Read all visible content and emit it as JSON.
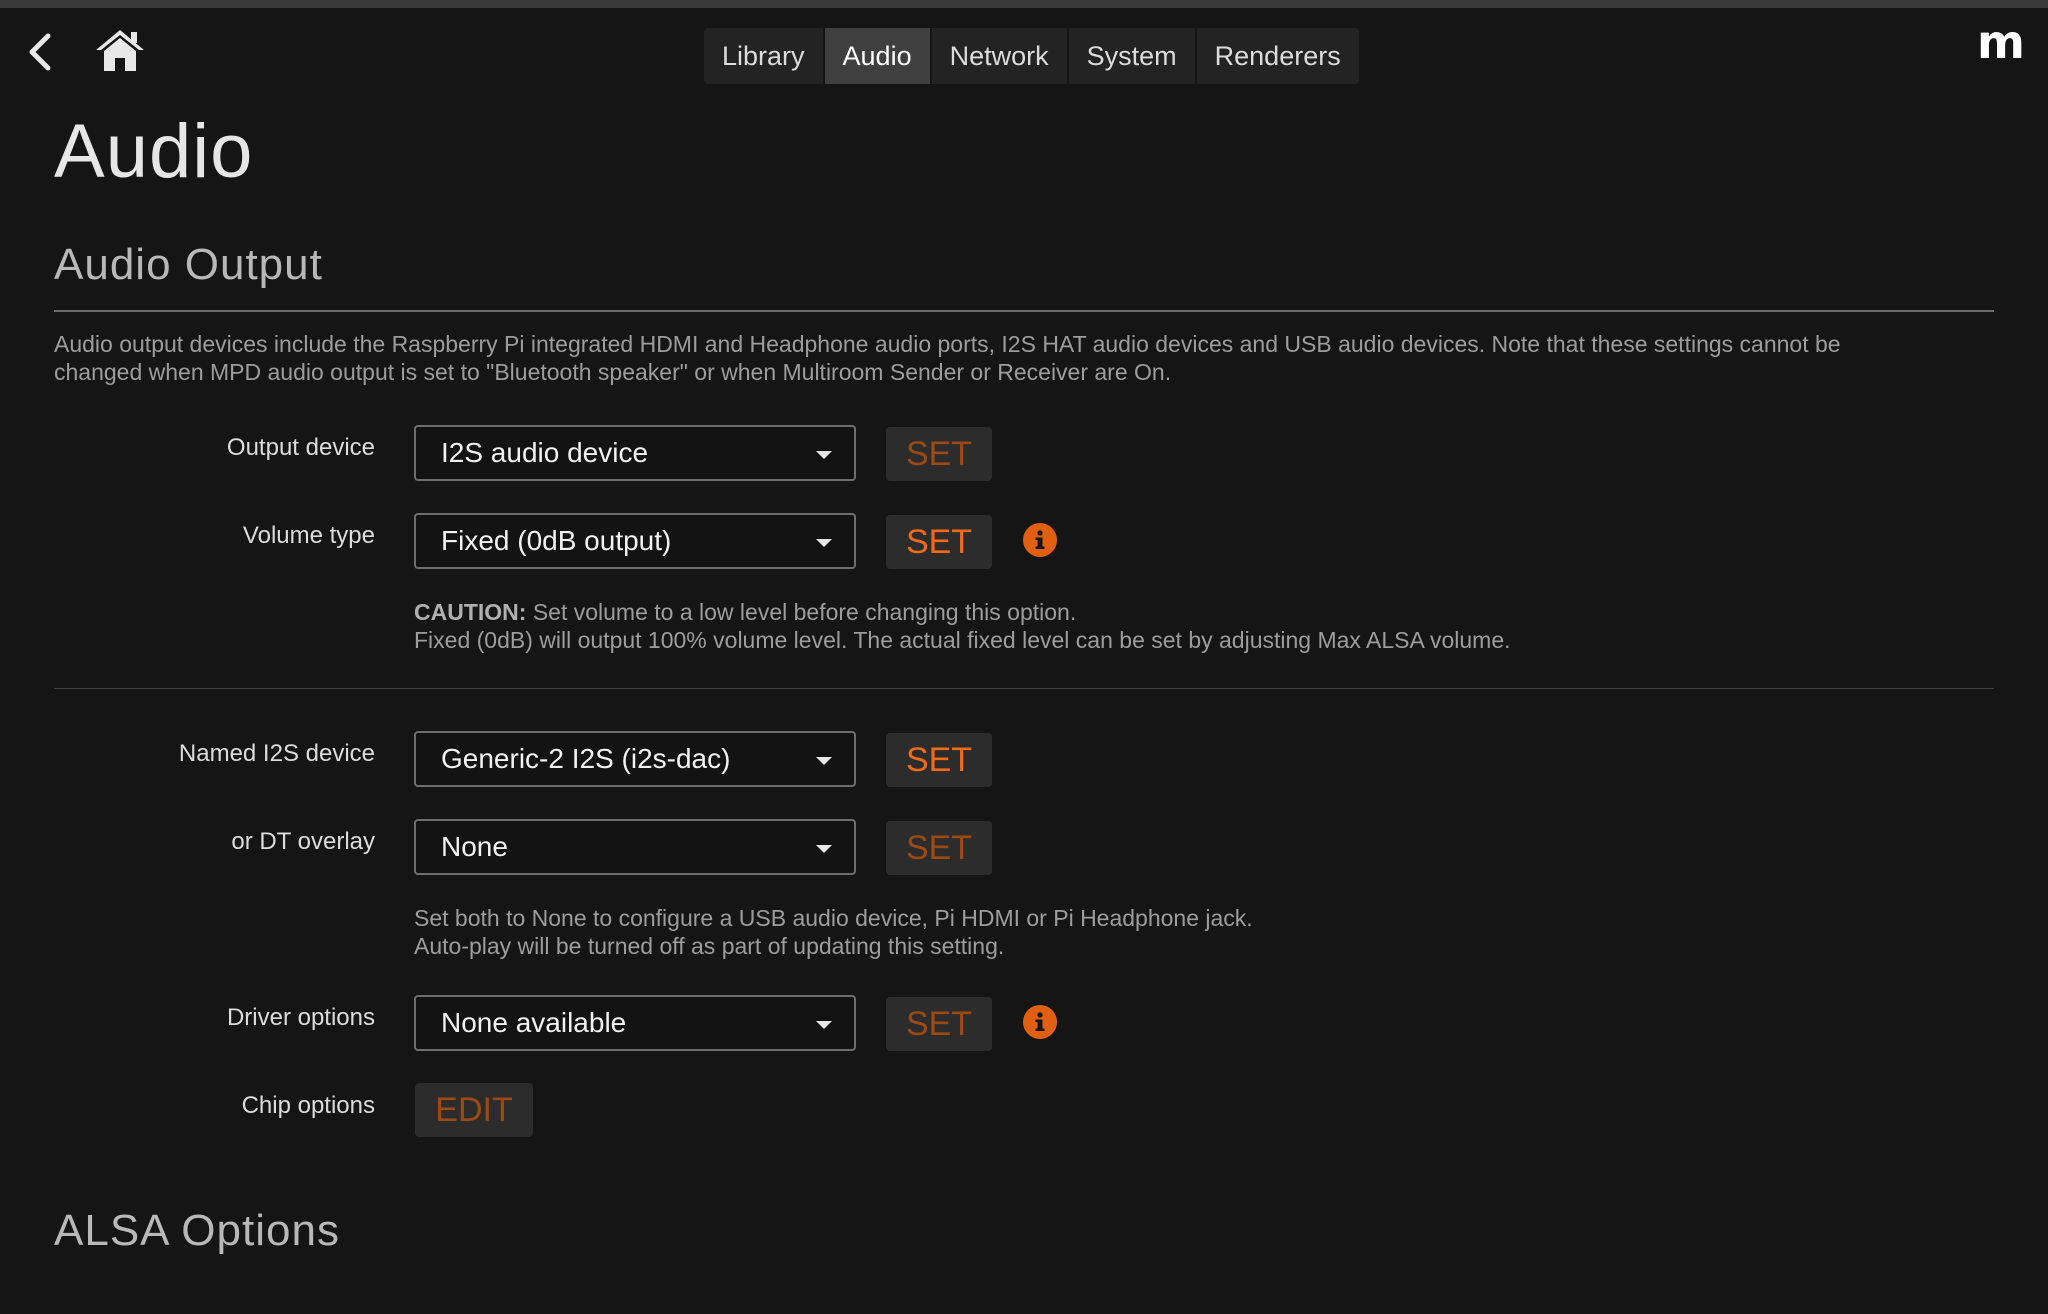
{
  "header": {
    "back_icon": "chevron-left-icon",
    "home_icon": "home-icon",
    "logo_text": "m",
    "tabs": [
      {
        "label": "Library"
      },
      {
        "label": "Audio"
      },
      {
        "label": "Network"
      },
      {
        "label": "System"
      },
      {
        "label": "Renderers"
      }
    ],
    "active_tab": "Audio"
  },
  "page": {
    "title": "Audio"
  },
  "audio_output": {
    "title": "Audio Output",
    "description_line1": "Audio output devices include the Raspberry Pi integrated HDMI and Headphone audio ports, I2S HAT audio devices and USB audio devices. Note that these settings cannot be",
    "description_line2": "changed when MPD audio output is set to \"Bluetooth speaker\" or when Multiroom Sender or Receiver are On.",
    "output_device": {
      "label": "Output device",
      "value": "I2S audio device",
      "button": "SET"
    },
    "volume_type": {
      "label": "Volume type",
      "value": "Fixed (0dB output)",
      "button": "SET"
    },
    "caution": {
      "prefix": "CAUTION:",
      "line1": " Set volume to a low level before changing this option.",
      "line2": "Fixed (0dB) will output 100% volume level. The actual fixed level can be set by adjusting Max ALSA volume."
    },
    "named_i2s": {
      "label": "Named I2S device",
      "value": "Generic-2 I2S (i2s-dac)",
      "button": "SET"
    },
    "dt_overlay": {
      "label": "or DT overlay",
      "value": "None",
      "button": "SET"
    },
    "i2s_note": {
      "line1": "Set both to None to configure a USB audio device, Pi HDMI or Pi Headphone jack.",
      "line2": "Auto-play will be turned off as part of updating this setting."
    },
    "driver_options": {
      "label": "Driver options",
      "value": "None available",
      "button": "SET"
    },
    "chip_options": {
      "label": "Chip options",
      "button": "EDIT"
    }
  },
  "alsa_options": {
    "title": "ALSA Options"
  },
  "colors": {
    "background": "#151515",
    "accent": "#ef6a19",
    "accent_dim": "#9c4a14",
    "info": "#e05f10"
  }
}
